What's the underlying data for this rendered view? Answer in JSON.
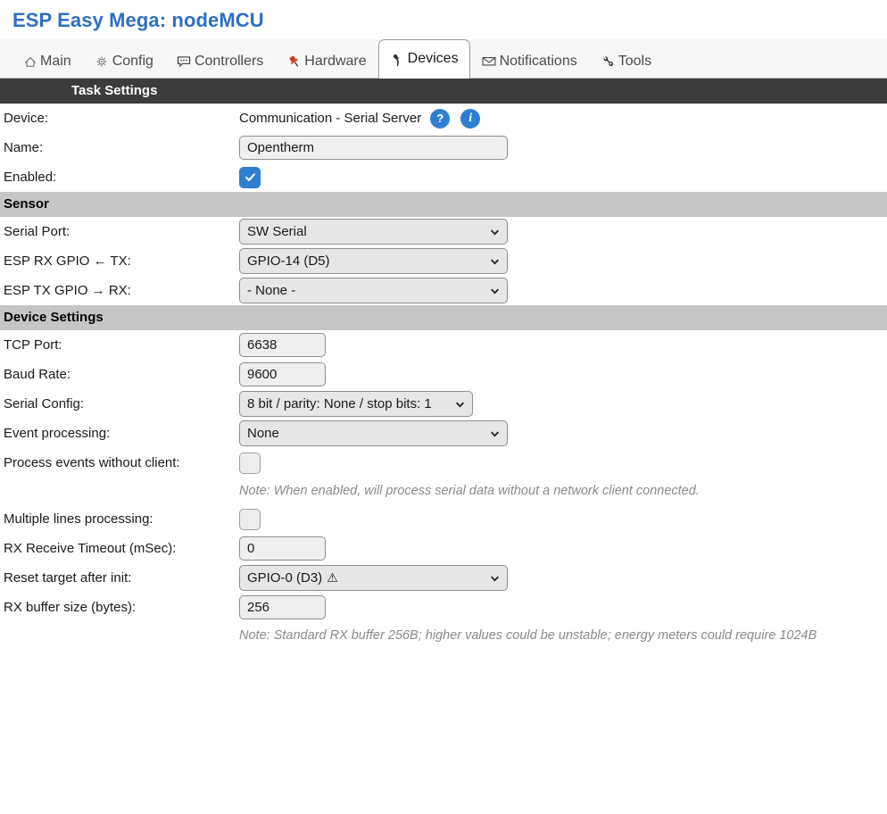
{
  "header": {
    "title": "ESP Easy Mega: nodeMCU"
  },
  "tabs": [
    {
      "label": "Main",
      "icon": "home-icon",
      "active": false
    },
    {
      "label": "Config",
      "icon": "gear-icon",
      "active": false
    },
    {
      "label": "Controllers",
      "icon": "speech-bubble-icon",
      "active": false
    },
    {
      "label": "Hardware",
      "icon": "pushpin-icon",
      "active": false
    },
    {
      "label": "Devices",
      "icon": "plug-icon",
      "active": true
    },
    {
      "label": "Notifications",
      "icon": "envelope-icon",
      "active": false
    },
    {
      "label": "Tools",
      "icon": "wrench-icon",
      "active": false
    }
  ],
  "sections": {
    "task_settings": "Task Settings",
    "sensor": "Sensor",
    "device_settings": "Device Settings"
  },
  "task_settings": {
    "device_label": "Device:",
    "device_value": "Communication - Serial Server",
    "help_badge": "?",
    "info_badge": "i",
    "name_label": "Name:",
    "name_value": "Opentherm",
    "enabled_label": "Enabled:",
    "enabled_checked": true
  },
  "sensor": {
    "serial_port_label": "Serial Port:",
    "serial_port_value": "SW Serial",
    "rx_gpio_label": "ESP RX GPIO ← TX:",
    "rx_gpio_value": "GPIO-14 (D5)",
    "tx_gpio_label": "ESP TX GPIO → RX:",
    "tx_gpio_value": "- None -"
  },
  "device_settings": {
    "tcp_port_label": "TCP Port:",
    "tcp_port_value": "6638",
    "baud_rate_label": "Baud Rate:",
    "baud_rate_value": "9600",
    "serial_config_label": "Serial Config:",
    "serial_config_value": "8 bit / parity: None / stop bits: 1",
    "event_processing_label": "Event processing:",
    "event_processing_value": "None",
    "process_events_label": "Process events without client:",
    "process_events_checked": false,
    "process_events_note": "Note: When enabled, will process serial data without a network client connected.",
    "multiple_lines_label": "Multiple lines processing:",
    "multiple_lines_checked": false,
    "rx_timeout_label": "RX Receive Timeout (mSec):",
    "rx_timeout_value": "0",
    "reset_target_label": "Reset target after init:",
    "reset_target_value": "GPIO-0 (D3)",
    "reset_target_warning": "⚠",
    "rx_buffer_label": "RX buffer size (bytes):",
    "rx_buffer_value": "256",
    "rx_buffer_note": "Note: Standard RX buffer 256B; higher values could be unstable; energy meters could require 1024B"
  },
  "colors": {
    "title": "#2f6fc4",
    "badge": "#2f7fd1",
    "section_dark": "#3c3c3c",
    "section_light": "#c6c6c6",
    "checkbox_on": "#2f7fd1"
  }
}
